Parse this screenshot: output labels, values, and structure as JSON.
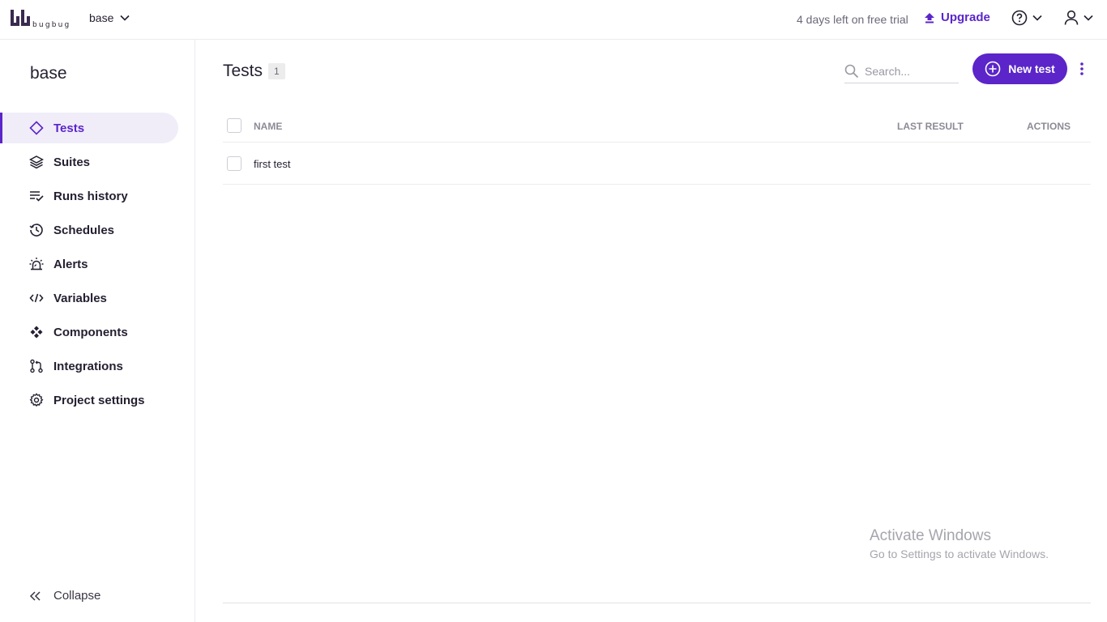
{
  "app": {
    "logo_text": "bugbug"
  },
  "topbar": {
    "project": "base",
    "trial": "4 days left on free trial",
    "upgrade": "Upgrade"
  },
  "sidebar": {
    "title": "base",
    "items": [
      {
        "label": "Tests",
        "icon": "diamond-icon",
        "active": true
      },
      {
        "label": "Suites",
        "icon": "layers-icon"
      },
      {
        "label": "Runs history",
        "icon": "list-check-icon"
      },
      {
        "label": "Schedules",
        "icon": "history-clock-icon"
      },
      {
        "label": "Alerts",
        "icon": "siren-icon"
      },
      {
        "label": "Variables",
        "icon": "code-icon"
      },
      {
        "label": "Components",
        "icon": "components-icon"
      },
      {
        "label": "Integrations",
        "icon": "git-pull-request-icon"
      },
      {
        "label": "Project settings",
        "icon": "gear-icon"
      }
    ],
    "collapse": "Collapse"
  },
  "main": {
    "title": "Tests",
    "count": "1",
    "search_placeholder": "Search...",
    "new_test": "New test",
    "columns": {
      "name": "NAME",
      "last_result": "LAST RESULT",
      "actions": "ACTIONS"
    },
    "rows": [
      {
        "name": "first test"
      }
    ]
  },
  "watermark": {
    "title": "Activate Windows",
    "subtitle": "Go to Settings to activate Windows."
  },
  "colors": {
    "accent": "#5b25c9",
    "active_bg": "#f0edf9"
  }
}
